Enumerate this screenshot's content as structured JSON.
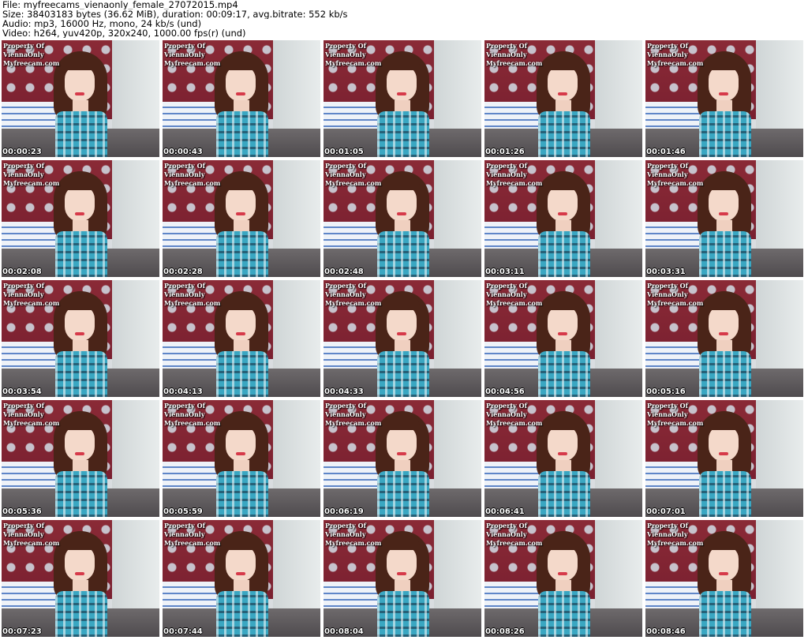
{
  "header": {
    "line1": "File: myfreecams_vienaonly_female_27072015.mp4",
    "line2": "Size: 38403183 bytes (36.62 MiB), duration: 00:09:17, avg.bitrate: 552 kb/s",
    "line3": "Audio: mp3, 16000 Hz, mono, 24 kb/s (und)",
    "line4": "Video: h264, yuv420p, 320x240, 1000.00 fps(r) (und)"
  },
  "watermark": {
    "line1": "Property Of",
    "line2": "ViennaOnly",
    "line3": "Myfreecam.com"
  },
  "thumbnails": [
    {
      "timestamp": "00:00:23"
    },
    {
      "timestamp": "00:00:43"
    },
    {
      "timestamp": "00:01:05"
    },
    {
      "timestamp": "00:01:26"
    },
    {
      "timestamp": "00:01:46"
    },
    {
      "timestamp": "00:02:08"
    },
    {
      "timestamp": "00:02:28"
    },
    {
      "timestamp": "00:02:48"
    },
    {
      "timestamp": "00:03:11"
    },
    {
      "timestamp": "00:03:31"
    },
    {
      "timestamp": "00:03:54"
    },
    {
      "timestamp": "00:04:13"
    },
    {
      "timestamp": "00:04:33"
    },
    {
      "timestamp": "00:04:56"
    },
    {
      "timestamp": "00:05:16"
    },
    {
      "timestamp": "00:05:36"
    },
    {
      "timestamp": "00:05:59"
    },
    {
      "timestamp": "00:06:19"
    },
    {
      "timestamp": "00:06:41"
    },
    {
      "timestamp": "00:07:01"
    },
    {
      "timestamp": "00:07:23"
    },
    {
      "timestamp": "00:07:44"
    },
    {
      "timestamp": "00:08:04"
    },
    {
      "timestamp": "00:08:26"
    },
    {
      "timestamp": "00:08:46"
    }
  ]
}
